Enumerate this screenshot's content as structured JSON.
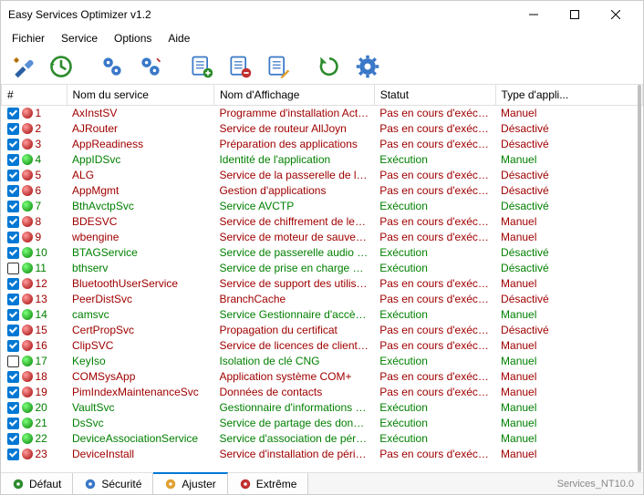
{
  "title": "Easy Services Optimizer v1.2",
  "menu": [
    "Fichier",
    "Service",
    "Options",
    "Aide"
  ],
  "columns": {
    "idx": "#",
    "name": "Nom du service",
    "display": "Nom d'Affichage",
    "status": "Statut",
    "type": "Type d'appli..."
  },
  "status_running": "Exécution",
  "status_notrunning": "Pas en cours d'exécution",
  "rows": [
    {
      "n": 1,
      "chk": true,
      "running": false,
      "svc": "AxInstSV",
      "disp": "Programme d'installation Active...",
      "type": "Manuel"
    },
    {
      "n": 2,
      "chk": true,
      "running": false,
      "svc": "AJRouter",
      "disp": "Service de routeur AllJoyn",
      "type": "Désactivé"
    },
    {
      "n": 3,
      "chk": true,
      "running": false,
      "svc": "AppReadiness",
      "disp": "Préparation des applications",
      "type": "Désactivé"
    },
    {
      "n": 4,
      "chk": true,
      "running": true,
      "svc": "AppIDSvc",
      "disp": "Identité de l'application",
      "type": "Manuel"
    },
    {
      "n": 5,
      "chk": true,
      "running": false,
      "svc": "ALG",
      "disp": "Service de la passerelle de la c...",
      "type": "Désactivé"
    },
    {
      "n": 6,
      "chk": true,
      "running": false,
      "svc": "AppMgmt",
      "disp": "Gestion d'applications",
      "type": "Désactivé"
    },
    {
      "n": 7,
      "chk": true,
      "running": true,
      "svc": "BthAvctpSvc",
      "disp": "Service AVCTP",
      "type": "Désactivé"
    },
    {
      "n": 8,
      "chk": true,
      "running": false,
      "svc": "BDESVC",
      "disp": "Service de chiffrement de lecte...",
      "type": "Manuel"
    },
    {
      "n": 9,
      "chk": true,
      "running": false,
      "svc": "wbengine",
      "disp": "Service de moteur de sauvegar...",
      "type": "Manuel"
    },
    {
      "n": 10,
      "chk": true,
      "running": true,
      "svc": "BTAGService",
      "disp": "Service de passerelle audio Blu...",
      "type": "Désactivé"
    },
    {
      "n": 11,
      "chk": false,
      "running": true,
      "svc": "bthserv",
      "disp": "Service de prise en charge Blue...",
      "type": "Désactivé"
    },
    {
      "n": 12,
      "chk": true,
      "running": false,
      "svc": "BluetoothUserService",
      "disp": "Service de support des utilisate...",
      "type": "Manuel"
    },
    {
      "n": 13,
      "chk": true,
      "running": false,
      "svc": "PeerDistSvc",
      "disp": "BranchCache",
      "type": "Désactivé"
    },
    {
      "n": 14,
      "chk": true,
      "running": true,
      "svc": "camsvc",
      "disp": "Service Gestionnaire d'accès au...",
      "type": "Manuel"
    },
    {
      "n": 15,
      "chk": true,
      "running": false,
      "svc": "CertPropSvc",
      "disp": "Propagation du certificat",
      "type": "Désactivé"
    },
    {
      "n": 16,
      "chk": true,
      "running": false,
      "svc": "ClipSVC",
      "disp": "Service de licences de client (Cli...",
      "type": "Manuel"
    },
    {
      "n": 17,
      "chk": false,
      "running": true,
      "svc": "KeyIso",
      "disp": "Isolation de clé CNG",
      "type": "Manuel"
    },
    {
      "n": 18,
      "chk": true,
      "running": false,
      "svc": "COMSysApp",
      "disp": "Application système COM+",
      "type": "Manuel"
    },
    {
      "n": 19,
      "chk": true,
      "running": false,
      "svc": "PimIndexMaintenanceSvc",
      "disp": "Données de contacts",
      "type": "Manuel"
    },
    {
      "n": 20,
      "chk": true,
      "running": true,
      "svc": "VaultSvc",
      "disp": "Gestionnaire d'informations d'id...",
      "type": "Manuel"
    },
    {
      "n": 21,
      "chk": true,
      "running": true,
      "svc": "DsSvc",
      "disp": "Service de partage des données",
      "type": "Manuel"
    },
    {
      "n": 22,
      "chk": true,
      "running": true,
      "svc": "DeviceAssociationService",
      "disp": "Service d'association de périph...",
      "type": "Manuel"
    },
    {
      "n": 23,
      "chk": true,
      "running": false,
      "svc": "DeviceInstall",
      "disp": "Service d'installation de périphé...",
      "type": "Manuel"
    }
  ],
  "tabs": {
    "default": "Défaut",
    "security": "Sécurité",
    "adjust": "Ajuster",
    "extreme": "Extrême"
  },
  "status_text": "Services_NT10.0"
}
